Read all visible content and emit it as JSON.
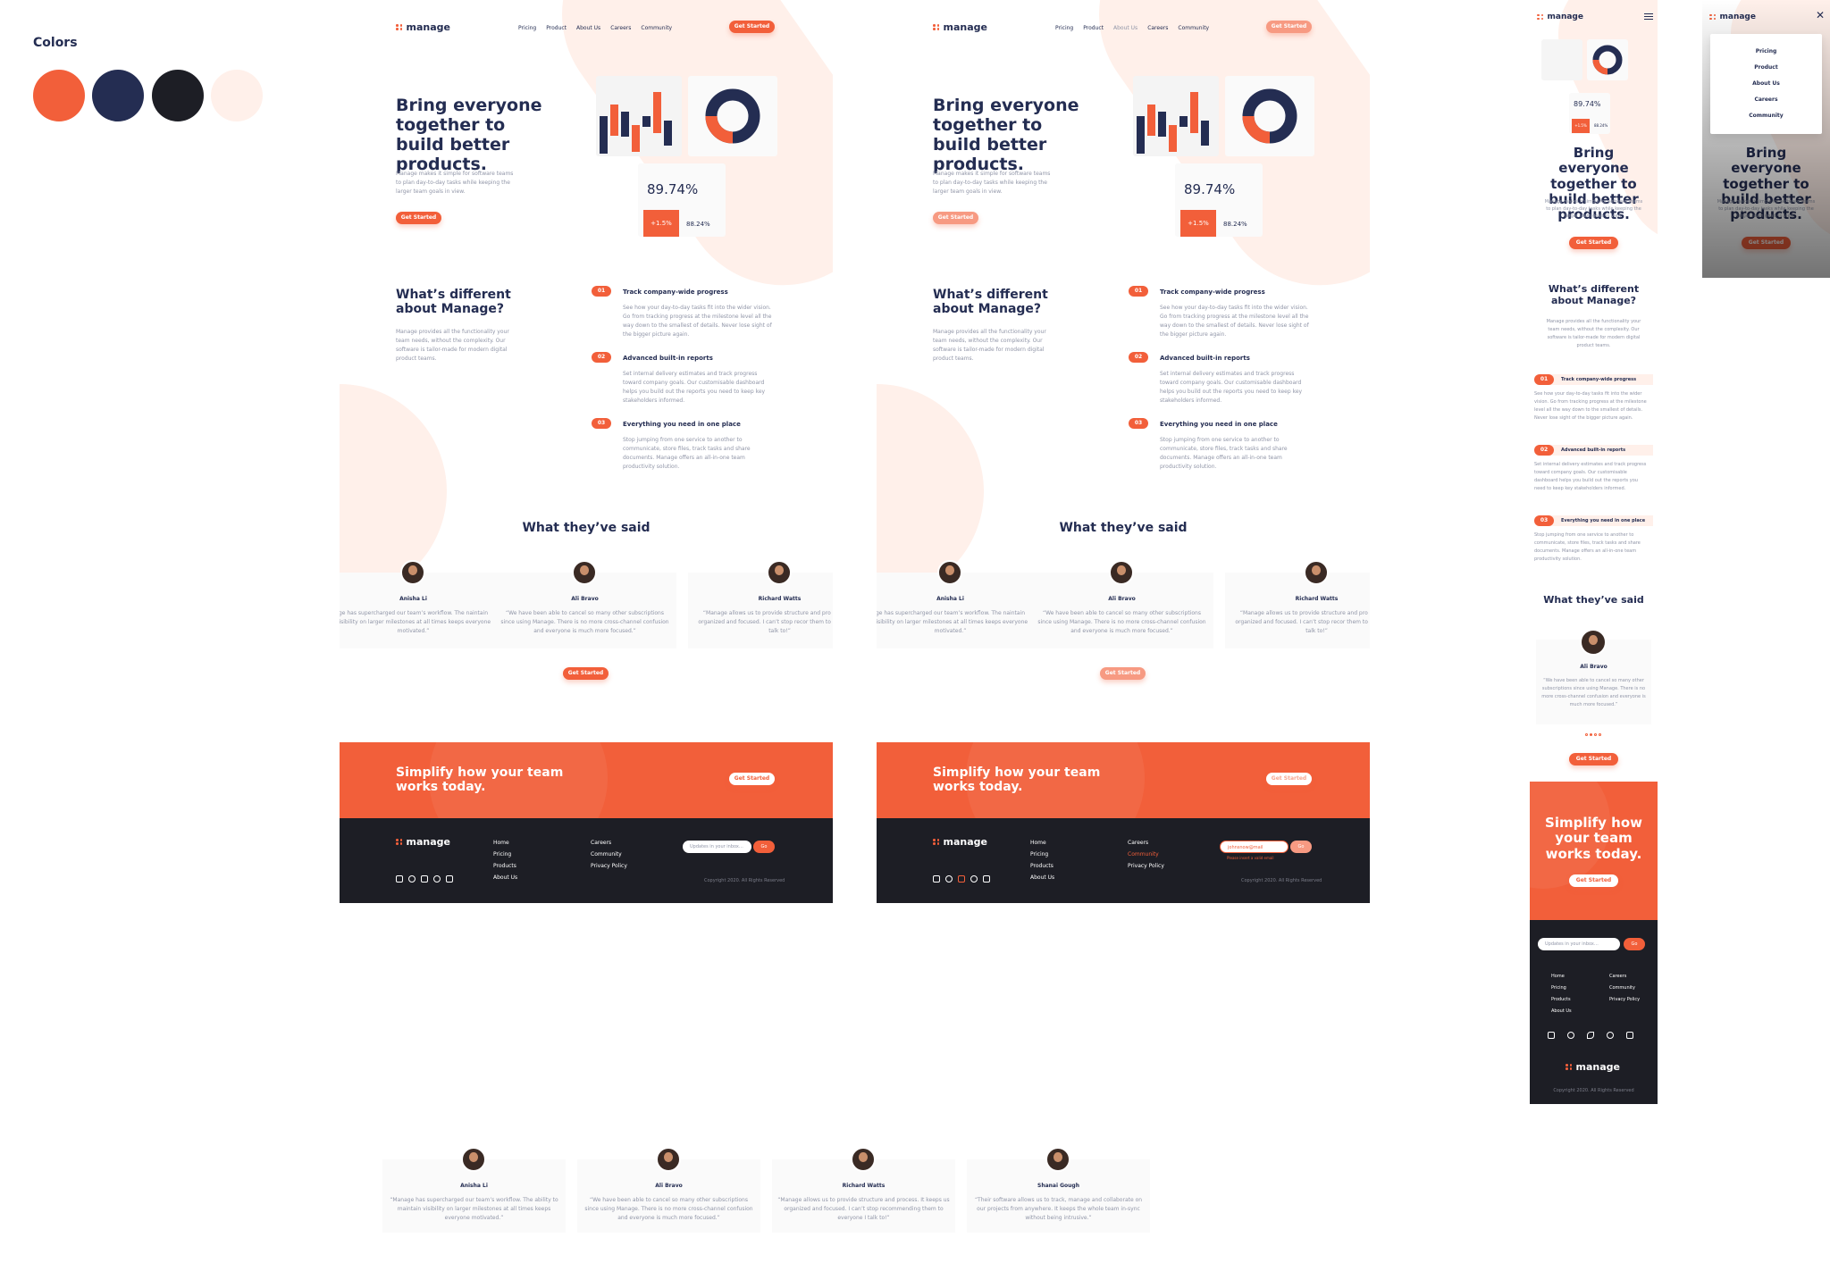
{
  "colors_section": {
    "title": "Colors",
    "swatches": [
      "#f25f3a",
      "#242d52",
      "#1d1e25",
      "#fff0ea"
    ]
  },
  "brand": {
    "name": "manage"
  },
  "nav": {
    "links": [
      "Pricing",
      "Product",
      "About Us",
      "Careers",
      "Community"
    ],
    "cta": "Get Started"
  },
  "hero": {
    "title": "Bring everyone together to build better products.",
    "subtitle": "Manage makes it simple for software teams to plan day-to-day tasks while keeping the larger team goals in view.",
    "cta": "Get Started",
    "stat_main": "89.74%",
    "stat_badge": "+1.5%",
    "stat_secondary": "88.24%"
  },
  "different": {
    "title": "What’s different about Manage?",
    "text": "Manage provides all the functionality your team needs, without the complexity. Our software is tailor-made for modern digital product teams.",
    "features": [
      {
        "num": "01",
        "title": "Track company-wide progress",
        "text": "See how your day-to-day tasks fit into the wider vision. Go from tracking progress at the milestone level all the way down to the smallest of details. Never lose sight of the bigger picture again."
      },
      {
        "num": "02",
        "title": "Advanced built-in reports",
        "text": "Set internal delivery estimates and track progress toward company goals. Our customisable dashboard helps you build out the reports you need to keep key stakeholders informed."
      },
      {
        "num": "03",
        "title": "Everything you need in one place",
        "text": "Stop jumping from one service to another to communicate, store files, track tasks and share documents. Manage offers an all-in-one team productivity solution."
      }
    ]
  },
  "testimonials": {
    "title": "What they’ve said",
    "cta": "Get Started",
    "items": [
      {
        "name": "Anisha Li",
        "quote": "“Manage has supercharged our team’s workflow. The ability to maintain visibility on larger milestones at all times keeps everyone motivated.”",
        "quote_cropped": "ge has supercharged our team’s workflow. The naintain visibility on larger milestones at all times keeps everyone motivated.”"
      },
      {
        "name": "Ali Bravo",
        "quote": "“We have been able to cancel so many other subscriptions since using Manage. There is no more cross-channel confusion and everyone is much more focused.”"
      },
      {
        "name": "Richard Watts",
        "quote": "“Manage allows us to provide structure and process. It keeps us organized and focused. I can’t stop recommending them to everyone I talk to!”",
        "quote_cropped": "“Manage allows us to provide structure and pro keeps us organized and focused. I can’t stop recor them to everyone I talk to!”"
      },
      {
        "name": "Shanai Gough",
        "quote": "“Their software allows us to track, manage and collaborate on our projects from anywhere. It keeps the whole team in-sync without being intrusive.”"
      }
    ]
  },
  "cta_banner": {
    "title": "Simplify how your team works today.",
    "button": "Get Started"
  },
  "footer": {
    "col1": [
      "Home",
      "Pricing",
      "Products",
      "About Us"
    ],
    "col2": [
      "Careers",
      "Community",
      "Privacy Policy"
    ],
    "email_placeholder": "Updates in your inbox…",
    "email_value_error": "johnsnow@mail",
    "error_text": "Please insert a valid email",
    "go": "Go",
    "copyright": "Copyright 2020. All Rights Reserved",
    "socials": [
      "facebook-icon",
      "youtube-icon",
      "twitter-icon",
      "pinterest-icon",
      "instagram-icon"
    ]
  },
  "mobile_menu": {
    "items": [
      "Pricing",
      "Product",
      "About Us",
      "Careers",
      "Community"
    ]
  }
}
